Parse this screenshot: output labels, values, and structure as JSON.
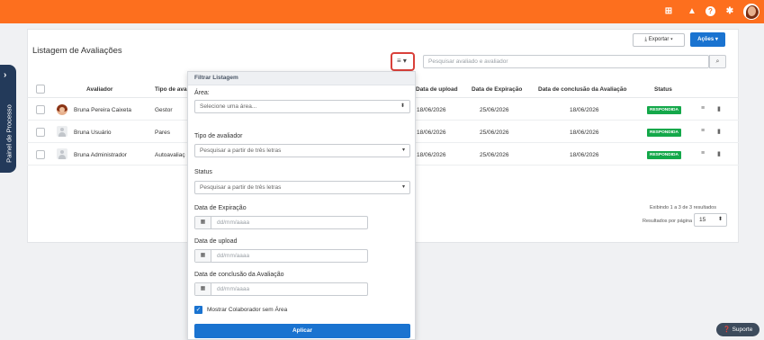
{
  "topbar": {
    "bg_color": "#fd6f1e",
    "icons": [
      "grid-icon",
      "bell-icon",
      "help-icon",
      "gear-icon"
    ]
  },
  "side_panel": {
    "label": "Painel de Processo"
  },
  "page": {
    "title": "Listagem de Avaliações",
    "export_label": "Exportar",
    "actions_label": "Ações",
    "search_placeholder": "Pesquisar avaliado e avaliador"
  },
  "table": {
    "columns": [
      "Avaliador",
      "Tipo de ava",
      "Data de upload",
      "Data de Expiração",
      "Data de conclusão da Avaliação",
      "Status"
    ],
    "rows": [
      {
        "avaliador": "Bruna Pereira Caixeta",
        "tipo": "Gestor",
        "upload": "18/06/2026",
        "expiracao": "25/06/2026",
        "conclusao": "18/06/2026",
        "status": "RESPONDIDA"
      },
      {
        "avaliador": "Bruna Usuário",
        "tipo": "Pares",
        "upload": "18/06/2026",
        "expiracao": "25/06/2026",
        "conclusao": "18/06/2026",
        "status": "RESPONDIDA"
      },
      {
        "avaliador": "Bruna Administrador",
        "tipo": "Autoavaliaç",
        "upload": "18/06/2026",
        "expiracao": "25/06/2026",
        "conclusao": "18/06/2026",
        "status": "RESPONDIDA"
      }
    ],
    "footer_info": "Exibindo 1 a 3 de 3 resultados",
    "per_page_label": "Resultados por página",
    "per_page_value": "15",
    "status_color": "#14a84a"
  },
  "filter": {
    "header": "Filtrar Listagem",
    "area_label": "Área:",
    "area_placeholder": "Selecione uma área...",
    "tipo_label": "Tipo de avaliador",
    "tipo_placeholder": "Pesquisar a partir de três letras",
    "status_label": "Status",
    "status_placeholder": "Pesquisar a partir de três letras",
    "expiracao_label": "Data de Expiração",
    "upload_label": "Data de upload",
    "conclusao_label": "Data de conclusão da Avaliação",
    "date_placeholder": "dd/mm/aaaa",
    "checkbox_label": "Mostrar Colaborador sem Área",
    "checkbox_checked": true,
    "apply_label": "Aplicar"
  },
  "support": {
    "label": "Suporte"
  },
  "accent_color": "#1a73d0"
}
